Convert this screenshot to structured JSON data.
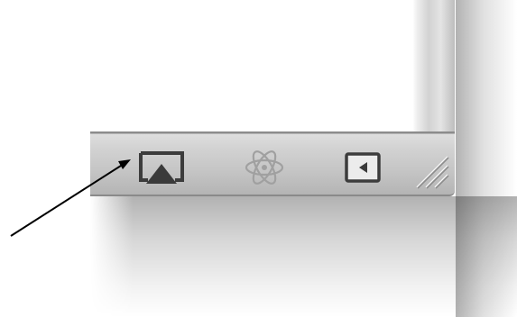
{
  "toolbar": {
    "buttons": [
      {
        "id": "airplay",
        "icon": "airplay-icon"
      },
      {
        "id": "atom",
        "icon": "atom-icon"
      },
      {
        "id": "back",
        "icon": "back-arrow-box-icon"
      }
    ],
    "resize_grip_icon": "resize-grip-icon"
  },
  "annotation": {
    "pointer": "arrow-icon",
    "target": "airplay"
  },
  "colors": {
    "toolbar_top": "#dedede",
    "toolbar_bottom": "#b4b4b4",
    "icon_dark": "#3a3a3a",
    "icon_faint": "#9e9e9e",
    "arrow": "#000000"
  }
}
